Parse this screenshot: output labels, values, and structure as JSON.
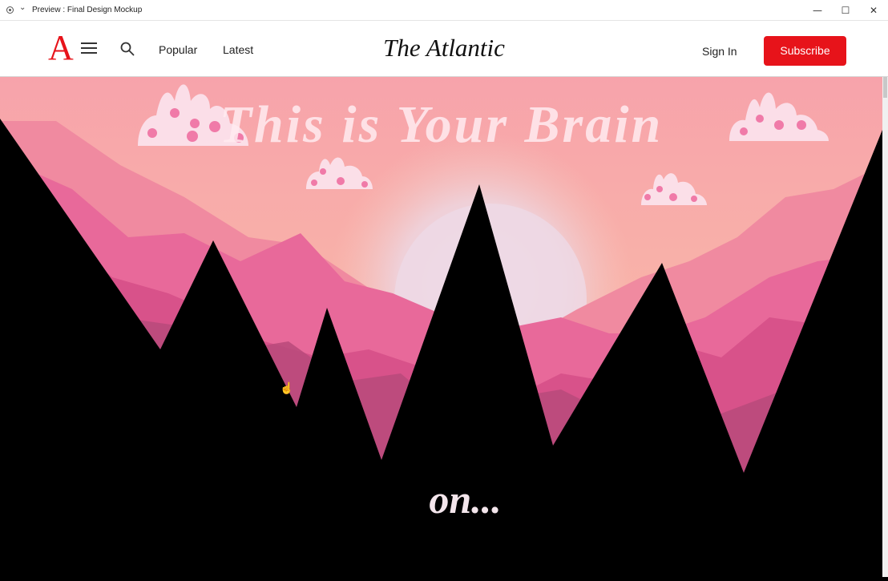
{
  "window": {
    "title": "Preview : Final Design Mockup",
    "chevron_glyph": "⌄",
    "minimize_glyph": "—",
    "maximize_glyph": "☐",
    "close_glyph": "✕"
  },
  "header": {
    "logo_letter": "A",
    "nav": {
      "popular": "Popular",
      "latest": "Latest"
    },
    "brand": "The Atlantic",
    "sign_in": "Sign In",
    "subscribe": "Subscribe"
  },
  "hero": {
    "title": "This is Your Brain",
    "subtitle": "on..."
  },
  "colors": {
    "brand_red": "#e7131a",
    "sky_pink": "#f6a6ad",
    "sun": "#efd7e5",
    "mountain_pink": "#e75f8f",
    "black": "#000000"
  }
}
